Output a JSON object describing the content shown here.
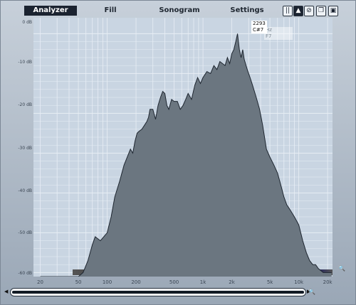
{
  "tabs": [
    {
      "label": "Analyzer",
      "active": true
    },
    {
      "label": "Fill",
      "active": false
    },
    {
      "label": "Sonogram",
      "active": false
    },
    {
      "label": "Settings",
      "active": false
    }
  ],
  "toolbar_icons": [
    "pause-icon",
    "triangle-icon",
    "no-entry-icon",
    "copy-icon",
    "save-icon"
  ],
  "y_ticks": [
    "0 dB",
    "-10 dB",
    "-20 dB",
    "-30 dB",
    "-40 dB",
    "-50 dB",
    "-60 dB"
  ],
  "x_ticks": [
    "20",
    "50",
    "100",
    "200",
    "500",
    "1k",
    "2k",
    "5k",
    "10k",
    "20k"
  ],
  "tooltip": {
    "line1": "2293 Hz",
    "line2": "C#7",
    "ghost1": "Hz",
    "ghost2": "F7"
  },
  "colors": {
    "fill": "#6b7680",
    "plot_bg": "#c9d5e2",
    "grid": "#e8eef5"
  },
  "chart_data": {
    "type": "area",
    "x_scale": "log",
    "x": [
      20,
      50,
      56,
      63,
      70,
      75,
      85,
      100,
      110,
      120,
      135,
      150,
      165,
      175,
      185,
      195,
      205,
      215,
      230,
      245,
      260,
      270,
      280,
      300,
      320,
      340,
      360,
      380,
      400,
      420,
      440,
      470,
      500,
      540,
      580,
      620,
      660,
      700,
      760,
      820,
      880,
      940,
      1000,
      1100,
      1200,
      1300,
      1400,
      1500,
      1600,
      1700,
      1800,
      1900,
      2000,
      2100,
      2200,
      2293,
      2400,
      2500,
      2600,
      2700,
      2900,
      3100,
      3300,
      3600,
      3900,
      4200,
      4600,
      5000,
      5500,
      6000,
      6500,
      7000,
      7500,
      8000,
      9000,
      10000,
      11000,
      12000,
      13000,
      14000,
      15000,
      16000,
      17000,
      18000,
      19000,
      20000,
      22000
    ],
    "y": [
      -61,
      -61,
      -60,
      -57,
      -53,
      -51,
      -52,
      -50,
      -46,
      -41,
      -37,
      -33,
      -30.5,
      -29,
      -30,
      -27,
      -25,
      -24.5,
      -24,
      -23,
      -22,
      -21,
      -19,
      -19,
      -21.5,
      -18,
      -16,
      -14.5,
      -15,
      -18,
      -19,
      -16.5,
      -17,
      -17,
      -19,
      -18,
      -16.5,
      -15,
      -16.5,
      -13,
      -11,
      -12.5,
      -11,
      -9.5,
      -10,
      -8,
      -9,
      -7,
      -7.5,
      -8,
      -6,
      -7.5,
      -5,
      -4,
      -2,
      0,
      -4,
      -6,
      -4,
      -6.5,
      -9,
      -11,
      -13,
      -16,
      -19,
      -23,
      -29,
      -31,
      -33,
      -35,
      -38,
      -41,
      -43,
      -44,
      -46,
      -48,
      -52,
      -55,
      -57,
      -58,
      -58,
      -59,
      -59.5,
      -60,
      -60,
      -60,
      -60
    ],
    "xlim": [
      17,
      22500
    ],
    "ylim": [
      -61,
      4
    ],
    "grid": true
  }
}
